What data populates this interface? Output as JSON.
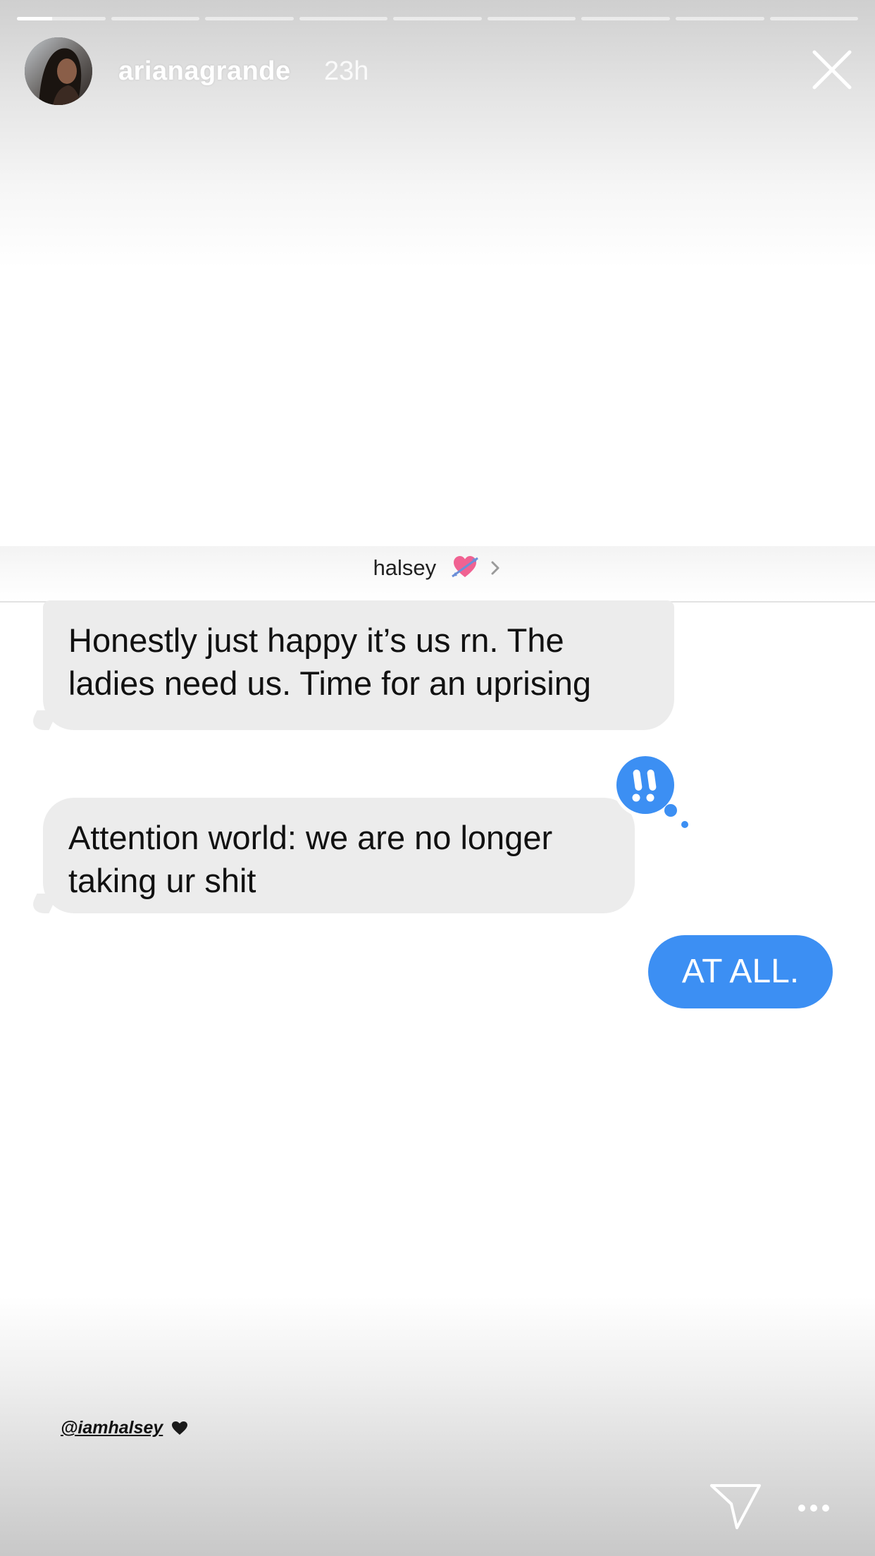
{
  "story": {
    "username": "arianagrande",
    "time": "23h",
    "segments_total": 9,
    "active_segment": 1,
    "active_segment_progress": 0.4
  },
  "conversation": {
    "contact_name": "halsey",
    "contact_emoji": "heart-with-arrow-icon",
    "messages": [
      {
        "direction": "incoming",
        "text": "Honestly just happy it’s us rn. The ladies need us. Time for an uprising"
      },
      {
        "direction": "incoming",
        "text": "Attention world: we are no longer taking ur shit"
      },
      {
        "direction": "outgoing",
        "text": "AT ALL."
      }
    ],
    "reaction": "double-exclamation-icon"
  },
  "sticker": {
    "mention": "@iamhalsey"
  },
  "colors": {
    "outgoing_bubble": "#3c8ff3",
    "incoming_bubble": "#ececec",
    "reaction_bubble": "#3c8ff3"
  }
}
